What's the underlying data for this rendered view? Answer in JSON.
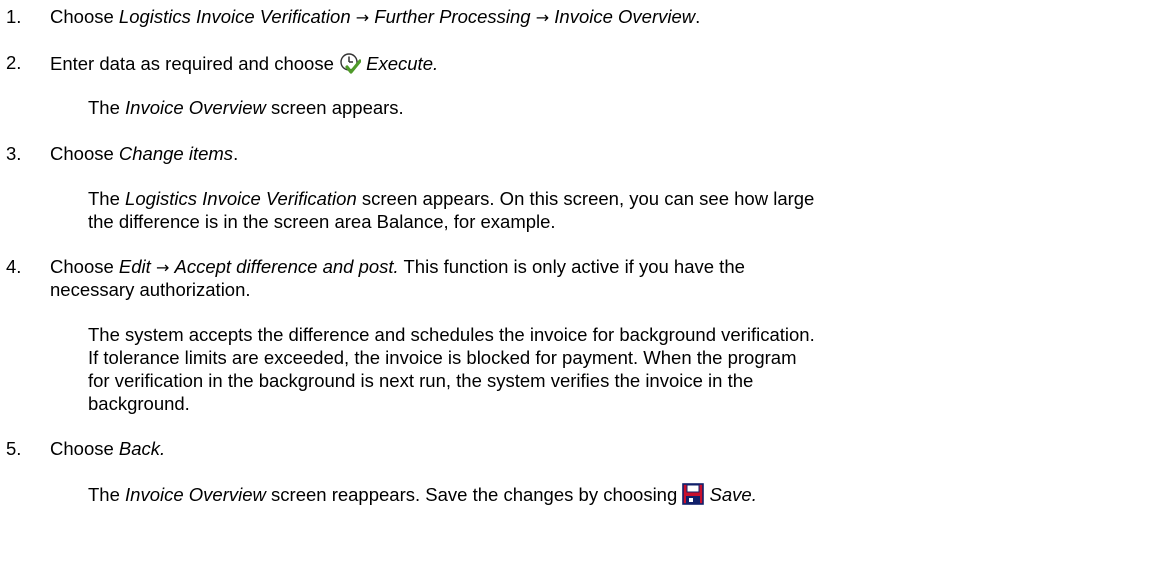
{
  "steps": [
    {
      "number": "1.",
      "text_prefix": "Choose ",
      "path": [
        "Logistics Invoice Verification",
        "Further Processing",
        "Invoice Overview"
      ],
      "text_suffix": "."
    },
    {
      "number": "2.",
      "text_prefix": "Enter data as required and choose",
      "icon": "execute-clock-check-icon",
      "action": "Execute.",
      "note": {
        "prefix": "The ",
        "italic": "Invoice Overview",
        "suffix": " screen appears."
      }
    },
    {
      "number": "3.",
      "text_prefix": "Choose ",
      "italic": "Change items",
      "text_suffix": ".",
      "note_lines": [
        {
          "prefix": "The ",
          "italic": "Logistics Invoice Verification",
          "suffix": " screen appears. On this screen, you can see how large"
        },
        {
          "text": "the difference is in the screen area Balance, for example."
        }
      ]
    },
    {
      "number": "4.",
      "text_prefix": "Choose ",
      "path": [
        "Edit",
        "Accept difference and post."
      ],
      "text_suffix": " This function is only active if you have the",
      "line2": "necessary authorization.",
      "note_lines": [
        "The system accepts the difference and schedules the invoice for background verification.",
        "If tolerance limits are exceeded, the invoice is blocked for payment. When the program",
        "for verification in the background is next run, the system verifies the invoice in the",
        "background."
      ]
    },
    {
      "number": "5.",
      "text_prefix": "Choose ",
      "italic": "Back.",
      "note": {
        "prefix": "The ",
        "italic": "Invoice Overview",
        "middle": " screen reappears. Save the changes by choosing",
        "icon": "save-floppy-icon",
        "action": "Save."
      }
    }
  ],
  "arrow_symbol": "→",
  "colors": {
    "execute_icon_green": "#4f9a2a",
    "save_icon_red": "#c8102e",
    "save_icon_navy": "#10206a"
  }
}
